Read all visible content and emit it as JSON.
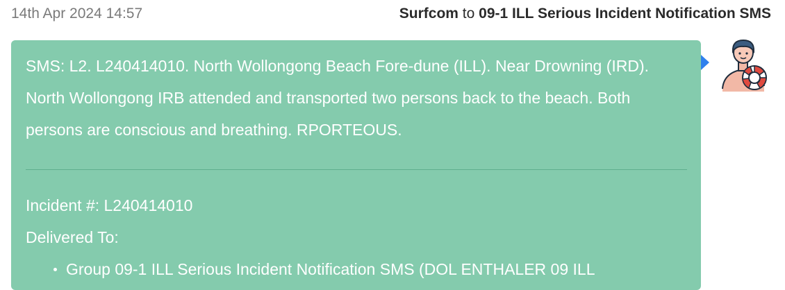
{
  "message": {
    "timestamp": "14th Apr 2024 14:57",
    "sender": "Surfcom",
    "to_word": "to",
    "recipient": "09-1 ILL Serious Incident Notification SMS",
    "body": "SMS: L2. L240414010. North Wollongong Beach Fore-dune (ILL). Near Drowning (IRD). North Wollongong IRB attended and transported two persons back to the beach. Both persons are conscious and breathing. RPORTEOUS.",
    "incident_line": "Incident #: L240414010",
    "delivered_label": "Delivered To:",
    "delivered_to": [
      "Group 09-1 ILL Serious Incident Notification SMS (DOL ENTHALER 09 ILL"
    ]
  },
  "avatar": {
    "icon": "lifeguard-avatar-icon"
  },
  "colors": {
    "bubble": "#84cbad",
    "pointer": "#2f80ed",
    "text_light": "#ffffff",
    "timestamp": "#7a7a7a"
  }
}
